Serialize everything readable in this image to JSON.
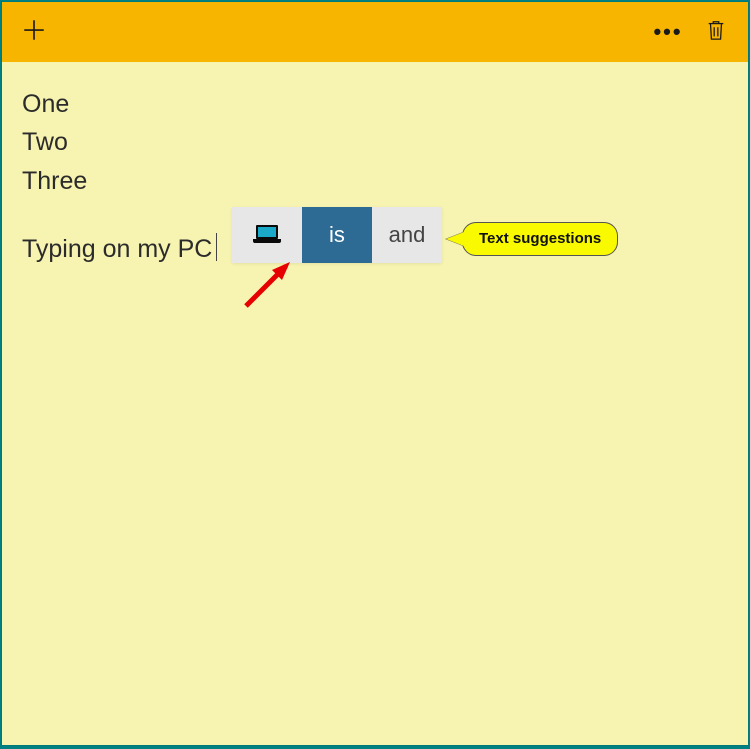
{
  "note": {
    "lines": [
      "One",
      "Two",
      "Three"
    ],
    "typing": "Typing on my PC"
  },
  "suggestions": {
    "items": [
      {
        "kind": "emoji",
        "name": "laptop-emoji"
      },
      {
        "kind": "text",
        "label": "is",
        "selected": true
      },
      {
        "kind": "text",
        "label": "and",
        "selected": false
      }
    ]
  },
  "annotation": {
    "callout": "Text suggestions"
  },
  "colors": {
    "titlebar": "#f8b500",
    "noteBg": "#f7f3b1",
    "suggSelected": "#2e6b94"
  }
}
